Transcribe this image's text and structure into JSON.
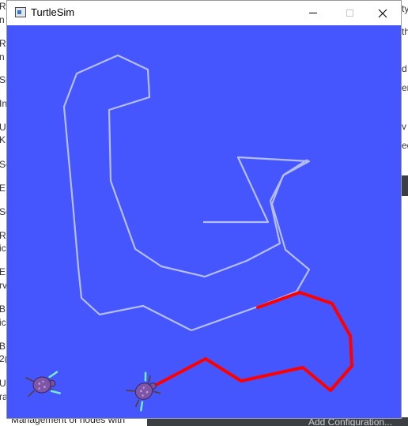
{
  "window": {
    "title": "TurtleSim",
    "controls": {
      "minimize": "minimize-icon",
      "maximize": "maximize-icon",
      "close": "close-icon"
    }
  },
  "canvas": {
    "background_color": "#4556ff",
    "turtles": [
      {
        "name": "turtle-1",
        "color": "#7f55a8"
      },
      {
        "name": "turtle-2",
        "color": "#7f55a8"
      }
    ],
    "trails": [
      {
        "name": "light-trail",
        "color": "#b4bff0"
      },
      {
        "name": "red-trail",
        "color": "#ff0000"
      }
    ]
  },
  "background": {
    "left_fragments": [
      "R",
      "n",
      "R",
      "n",
      "Si",
      "In",
      "U",
      "K",
      "Sc",
      "E",
      "Sc",
      "R",
      "ic",
      "E",
      "rv",
      "B",
      "ic",
      "B",
      "2(",
      "U",
      "ra"
    ],
    "right_fragments": [
      "ty",
      "th",
      "d",
      "er",
      "v",
      "ed"
    ],
    "bottom_left_text": "Management of nodes with",
    "bottom_right_text": "Add Configuration..."
  }
}
